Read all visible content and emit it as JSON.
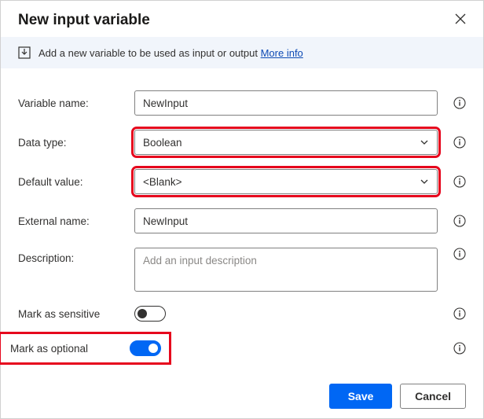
{
  "dialog": {
    "title": "New input variable",
    "banner_text": "Add a new variable to be used as input or output",
    "banner_link": "More info"
  },
  "fields": {
    "variable_name": {
      "label": "Variable name:",
      "value": "NewInput"
    },
    "data_type": {
      "label": "Data type:",
      "value": "Boolean"
    },
    "default_value": {
      "label": "Default value:",
      "value": "<Blank>"
    },
    "external_name": {
      "label": "External name:",
      "value": "NewInput"
    },
    "description": {
      "label": "Description:",
      "placeholder": "Add an input description"
    },
    "mark_sensitive": {
      "label": "Mark as sensitive",
      "on": false
    },
    "mark_optional": {
      "label": "Mark as optional",
      "on": true
    }
  },
  "footer": {
    "save": "Save",
    "cancel": "Cancel"
  }
}
